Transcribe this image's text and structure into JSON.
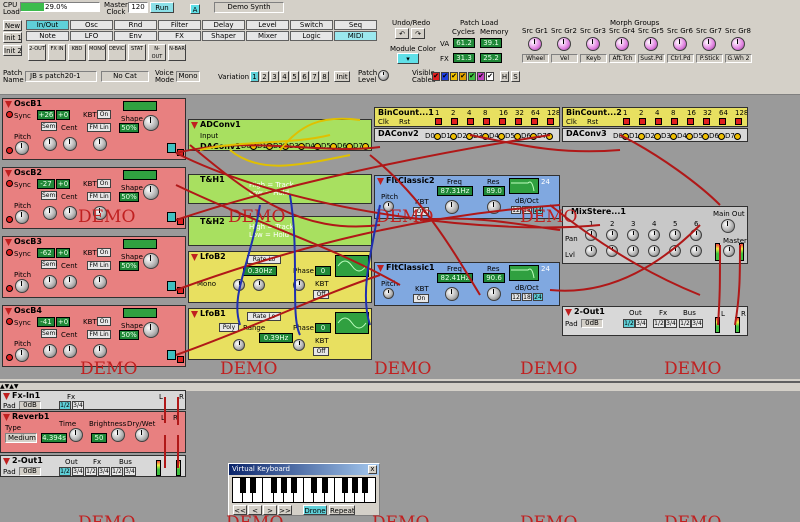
{
  "toolbar": {
    "cpu_label": "CPU\nLoad",
    "cpu_value": "29.0%",
    "cpu_fraction": 0.29,
    "master_clock_label": "Master\nClock",
    "clock_value": "120",
    "run_label": "Run",
    "a_label": "A",
    "patch_title": "Demo Synth",
    "new_label": "New",
    "init1_label": "Init 1",
    "init2_label": "Init 2",
    "cat_row1": [
      "In/Out",
      "Osc",
      "Rnd",
      "Filter",
      "Delay",
      "Level",
      "Switch",
      "Seq"
    ],
    "cat_row2": [
      "Note",
      "LFO",
      "Env",
      "FX",
      "Shaper",
      "Mixer",
      "Logic",
      "MIDI"
    ],
    "mini_icons": [
      "2-OUT",
      "FX IN",
      "KBD",
      "MONO",
      "DEVICE",
      "STAT",
      "N-OUT",
      "N-BAR"
    ],
    "undo_redo_label": "Undo/Redo",
    "module_color_label": "Module Color",
    "patch_load_label": "Patch Load",
    "cycles_label": "Cycles",
    "memory_label": "Memory",
    "va_label": "VA",
    "fx_label": "FX",
    "va_cycles": "61.2",
    "va_memory": "39.1",
    "fx_cycles": "31.3",
    "fx_memory": "25.2",
    "morph_groups_label": "Morph Groups",
    "morph_src": [
      "Src Gr1",
      "Src Gr2",
      "Src Gr3",
      "Src Gr4",
      "Src Gr5",
      "Src Gr6",
      "Src Gr7",
      "Src Gr8"
    ],
    "morph_names": [
      "Wheel",
      "Vel",
      "Keyb",
      "Aft.Tch",
      "Sust.Pd",
      "Ctrl.Pd",
      "P.Stick",
      "G.Wh 2"
    ],
    "patch_name_label": "Patch\nName",
    "patch_name": "JB s patch20-1",
    "category": "No Cat",
    "voice_mode_label": "Voice\nMode",
    "voice_mode": "Mono",
    "variation_label": "Variation",
    "variations": [
      "1",
      "2",
      "3",
      "4",
      "5",
      "6",
      "7",
      "8"
    ],
    "init_label": "Init",
    "patch_level_label": "Patch\nLevel",
    "visible_cables_label": "Visible\nCables",
    "h_label": "H",
    "s_label": "S"
  },
  "modules": {
    "osc": [
      {
        "name": "OscB1",
        "value": "+26",
        "sub": "+0",
        "shape": "50%"
      },
      {
        "name": "OscB2",
        "value": "-27",
        "sub": "+0",
        "shape": "50%"
      },
      {
        "name": "OscB3",
        "value": "-62",
        "sub": "+0",
        "shape": "50%"
      },
      {
        "name": "OscB4",
        "value": "-41",
        "sub": "+0",
        "shape": "50%"
      }
    ],
    "osc_labels": {
      "sync": "Sync",
      "pitch": "Pitch",
      "kbt": "KBT",
      "on": "On",
      "semi": "Semi",
      "cent": "Cent",
      "fmlin": "FM Lin",
      "shape": "Shape"
    },
    "adconv": {
      "name": "ADConv1",
      "input": "Input"
    },
    "daconv1": {
      "name": "DAConv1",
      "bits": [
        "D0",
        "D1",
        "D2",
        "D3",
        "D4",
        "D5",
        "D6",
        "D7"
      ]
    },
    "t_h1": {
      "name": "T&H1",
      "text1": "High = Track",
      "text2": "Low = Hold"
    },
    "t_h2": {
      "name": "T&H2",
      "text1": "High = Track",
      "text2": "Low = Hold"
    },
    "binc1": {
      "name": "BinCount...1",
      "clk": "Clk",
      "rst": "Rst",
      "steps": [
        "1",
        "2",
        "4",
        "8",
        "16",
        "32",
        "64",
        "128"
      ]
    },
    "binc2": {
      "name": "BinCount...2",
      "clk": "Clk",
      "rst": "Rst",
      "steps": [
        "1",
        "2",
        "4",
        "8",
        "16",
        "32",
        "64",
        "128"
      ]
    },
    "daconv2": {
      "name": "DAConv2",
      "bits": [
        "D0",
        "D1",
        "D2",
        "D3",
        "D4",
        "D5",
        "D6",
        "D7"
      ]
    },
    "daconv3": {
      "name": "DAConv3",
      "bits": [
        "D0",
        "D1",
        "D2",
        "D3",
        "D4",
        "D5",
        "D6",
        "D7"
      ]
    },
    "flt2": {
      "name": "FltClassic2",
      "freq_label": "Freq",
      "freq": "87.31Hz",
      "res_label": "Res",
      "res": "89.0",
      "slope": "24",
      "db_oct": "dB/Oct",
      "s1": "12",
      "s2": "18",
      "s3": "24",
      "kbt": "KBT",
      "kbt_val": "Off",
      "pitch": "Pitch"
    },
    "flt1": {
      "name": "FltClassic1",
      "freq_label": "Freq",
      "freq": "82.41Hz",
      "res_label": "Res",
      "res": "90.6",
      "slope": "24",
      "db_oct": "dB/Oct",
      "s1": "12",
      "s2": "18",
      "s3": "24",
      "kbt": "KBT",
      "kbt_val": "On",
      "pitch": "Pitch"
    },
    "lfob2": {
      "name": "LfoB2",
      "rate_label": "Rate",
      "rate_mode": "Lo",
      "rate": "0.30Hz",
      "phase_label": "Phase",
      "phase": "0",
      "mode_label": "Mono",
      "kbt": "KBT",
      "kbt_val": "Off"
    },
    "lfob1": {
      "name": "LfoB1",
      "rate_label": "Rate",
      "rate_mode": "Lo",
      "rate": "0.39Hz",
      "phase_label": "Phase",
      "phase": "0",
      "mode_label": "Poly",
      "kbt": "KBT",
      "kbt_val": "Off",
      "range": "Range"
    },
    "mixer": {
      "name": "MixStere...1",
      "main_out": "Main Out",
      "master": "Master",
      "pan": "Pan",
      "lvl": "Lvl",
      "channels": [
        "1",
        "2",
        "3",
        "4",
        "5",
        "6"
      ],
      "l": "L",
      "r": "R"
    },
    "out1": {
      "name": "2-Out1",
      "out_label": "Out",
      "fx_label": "Fx",
      "bus_label": "Bus",
      "pad": "Pad",
      "pad_val": "0dB",
      "out_opts": [
        "1/2",
        "3/4"
      ],
      "fx_opts": [
        "1/2",
        "3/4"
      ],
      "bus_opts": [
        "1/2",
        "3/4"
      ],
      "l": "L",
      "r": "R"
    }
  },
  "fx_area": {
    "fxin": {
      "name": "Fx-In1",
      "fx_label": "Fx",
      "pad": "Pad",
      "pad_val": "0dB",
      "opts": [
        "1/2",
        "3/4"
      ],
      "l": "L",
      "r": "R"
    },
    "reverb": {
      "name": "Reverb1",
      "type_label": "Type",
      "type": "Medium",
      "time_label": "Time",
      "time": "4.394s",
      "brightness_label": "Brightness",
      "brightness": "50",
      "drywet_label": "Dry/Wet",
      "l": "L",
      "r": "R"
    },
    "out2": {
      "name": "2-Out1",
      "out_label": "Out",
      "fx_label": "Fx",
      "bus_label": "Bus",
      "pad": "Pad",
      "pad_val": "0dB",
      "opts": [
        "1/2",
        "3/4",
        "1/2",
        "3/4",
        "1/2",
        "3/4"
      ]
    }
  },
  "keyboard": {
    "title": "Virtual Keyboard",
    "close": "x",
    "nav": [
      "<<",
      "<",
      ">",
      ">>"
    ],
    "drone": "Drone",
    "repeat": "Repeat"
  },
  "demo_text": "DEMO",
  "colors": {
    "osc": "#e88080",
    "yellow": "#e8e060",
    "green": "#a8e060",
    "blue": "#80a8e0",
    "cable_red": "#b01818",
    "cable_blue": "#2030b0",
    "cable_yellow": "#e0c000",
    "accent_cyan": "#5fd0d8"
  }
}
